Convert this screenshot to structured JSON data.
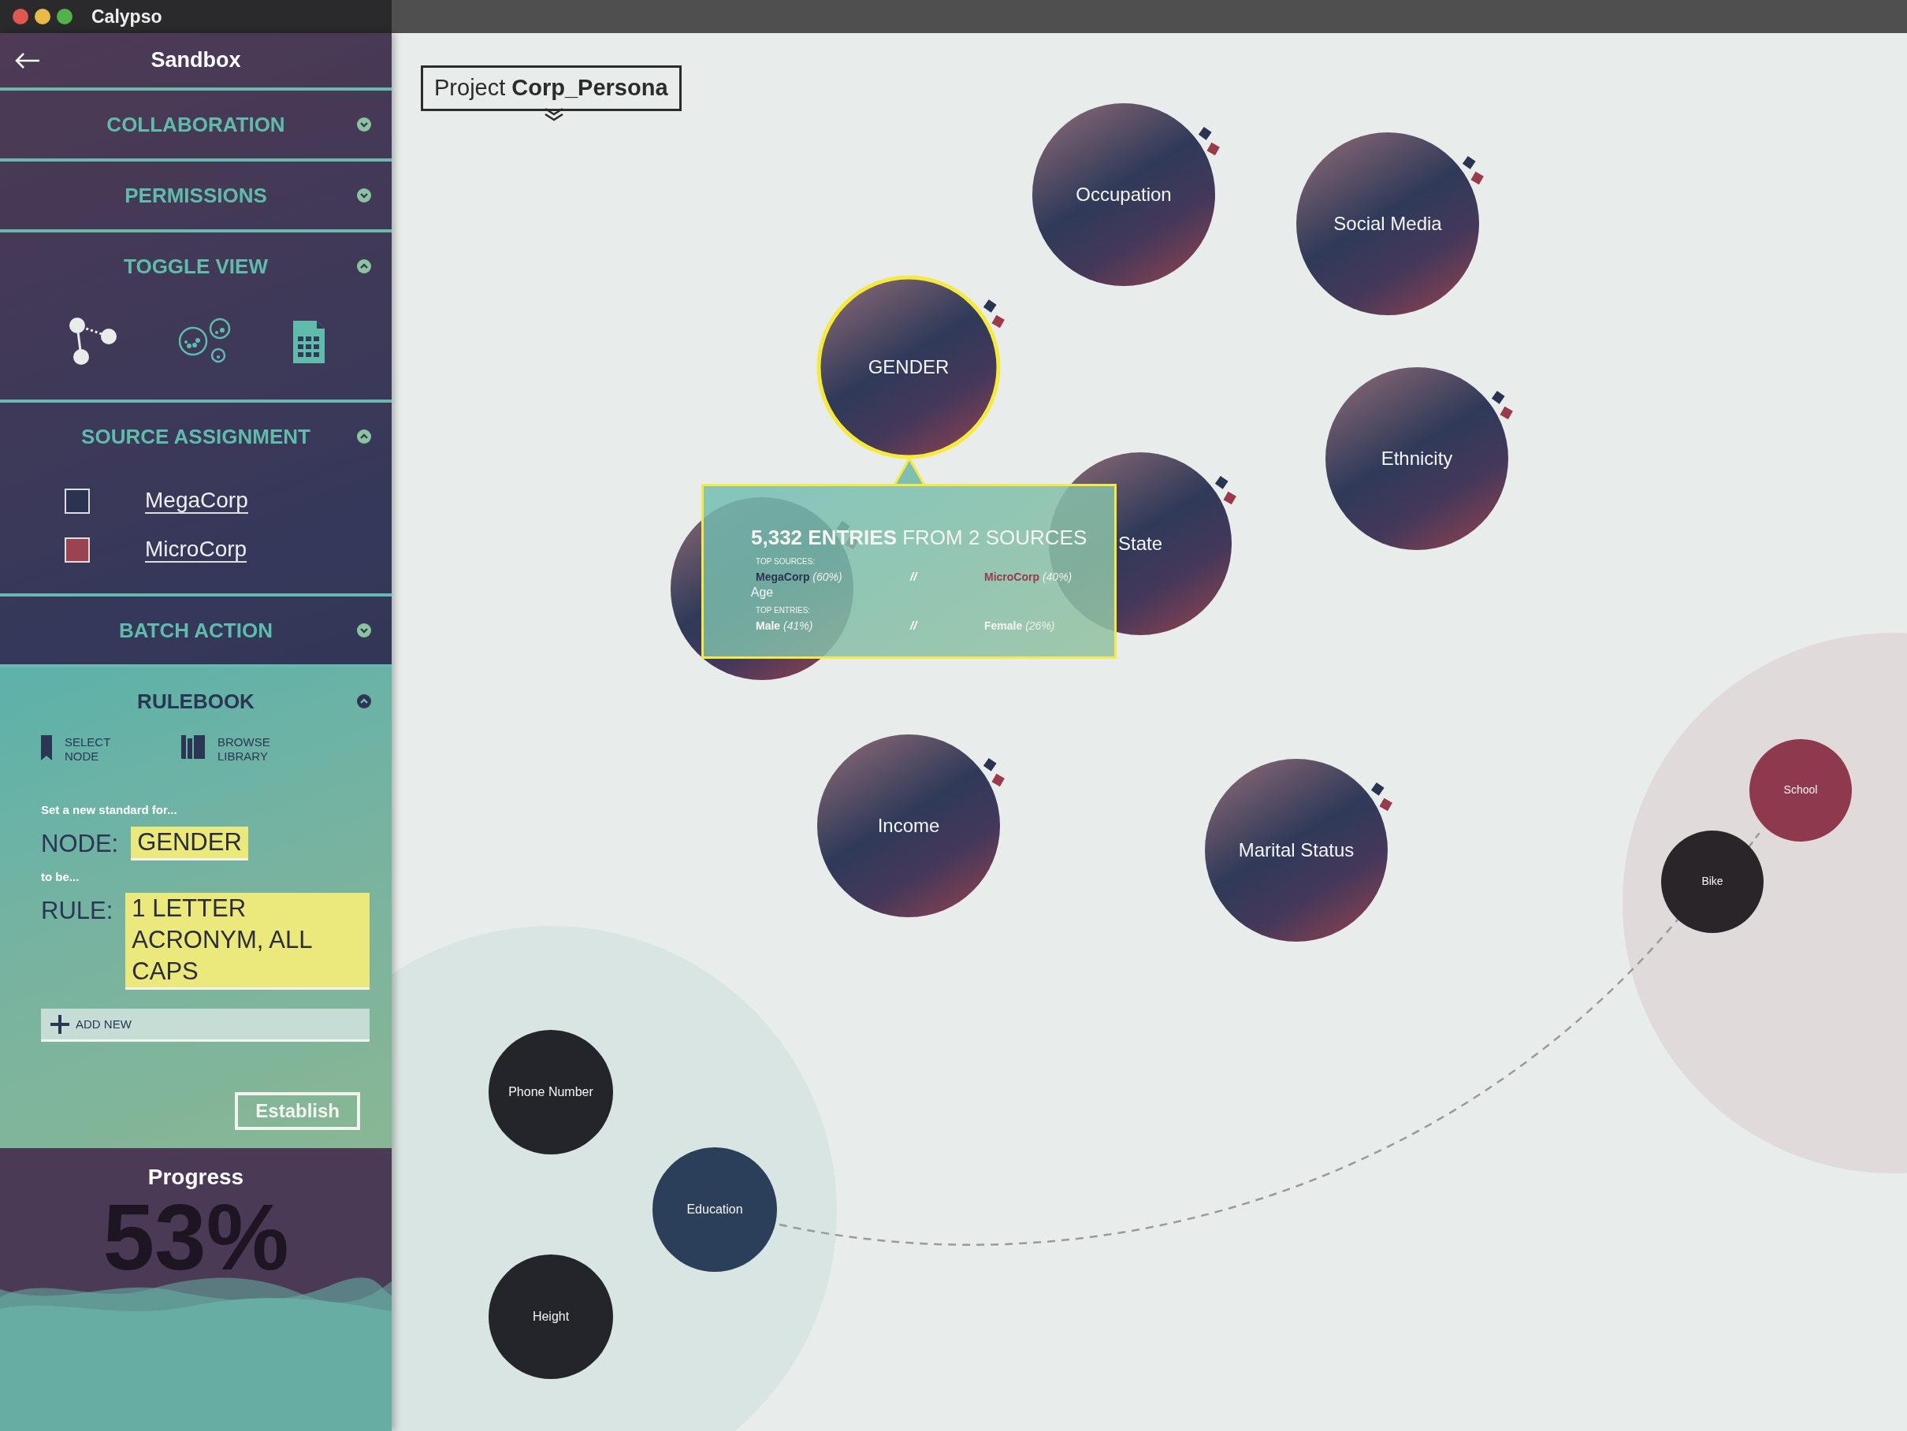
{
  "window": {
    "title": "Calypso"
  },
  "sidebar": {
    "title": "Sandbox",
    "sections": [
      {
        "kind": "header",
        "label": "COLLABORATION",
        "expanded": false
      },
      {
        "kind": "header",
        "label": "PERMISSIONS",
        "expanded": false
      },
      {
        "kind": "toggle_view",
        "label": "TOGGLE VIEW",
        "expanded": true
      },
      {
        "kind": "sources",
        "label": "SOURCE ASSIGNMENT",
        "expanded": true,
        "sources": [
          {
            "name": "MegaCorp",
            "color": "#2a3452"
          },
          {
            "name": "MicroCorp",
            "color": "#9a4452"
          }
        ]
      },
      {
        "kind": "header",
        "label": "BATCH ACTION",
        "expanded": false
      },
      {
        "kind": "rulebook",
        "label": "RULEBOOK",
        "expanded": true,
        "tools": [
          "SELECT NODE",
          "BROWSE LIBRARY"
        ],
        "intro": "Set a new standard for...",
        "node_label": "NODE:",
        "node_value": "GENDER",
        "connector": "to be...",
        "rule_label": "RULE:",
        "rule_value": "1 LETTER ACRONYM, ALL CAPS",
        "add_label": "ADD NEW",
        "button": "Establish"
      }
    ]
  },
  "progress": {
    "title": "Progress",
    "value": "53%"
  },
  "canvas": {
    "project": "Project **Corp_Persona**",
    "nodes": [
      {
        "label": "Occupation",
        "selected": false
      },
      {
        "label": "Social Media",
        "selected": false
      },
      {
        "label": "GENDER",
        "selected": true
      },
      {
        "label": "Ethnicity",
        "selected": false
      },
      {
        "label": "State",
        "selected": false
      },
      {
        "label": "Age",
        "selected": false
      },
      {
        "label": "Income",
        "selected": false
      },
      {
        "label": "Marital Status",
        "selected": false
      }
    ],
    "clusters": [
      {
        "nodes": [
          {
            "label": "Phone Number",
            "color": "#23252b"
          },
          {
            "label": "Education",
            "color": "#2b3f5a"
          },
          {
            "label": "Height",
            "color": "#23252b"
          }
        ]
      },
      {
        "nodes": [
          {
            "label": "School",
            "color": "#8e3a4c"
          },
          {
            "label": "Bike",
            "color": "#2a2529"
          }
        ]
      }
    ],
    "tooltip": {
      "headline": "**5,332 ENTRIES** FROM 2 SOURCES",
      "rows": [
        {
          "heading": "TOP SOURCES:",
          "left": {
            "name": "MegaCorp",
            "share": "(60%)",
            "color": "#2a3452"
          },
          "separator": "//",
          "right": {
            "name": "MicroCorp",
            "share": "(40%)",
            "color": "#9a3a4a"
          }
        },
        {
          "heading": "TOP ENTRIES:",
          "left": {
            "name": "Male",
            "share": "(41%)"
          },
          "separator": "//",
          "right": {
            "name": "Female",
            "share": "(26%)"
          }
        }
      ]
    }
  }
}
